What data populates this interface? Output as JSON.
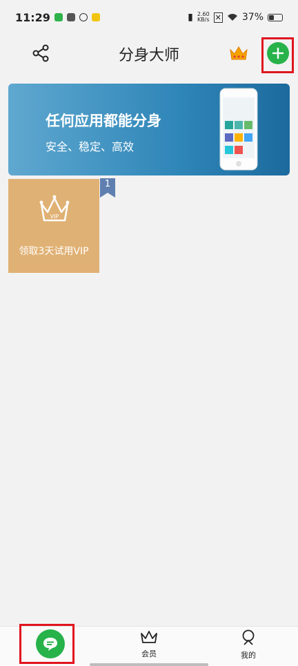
{
  "status_bar": {
    "time": "11:29",
    "speed_value": "2.60",
    "speed_unit": "KB/s",
    "battery": "37%"
  },
  "header": {
    "title": "分身大师",
    "icons": {
      "share": "share-icon",
      "crown": "crown-icon",
      "add": "plus-icon"
    }
  },
  "banner": {
    "title": "任何应用都能分身",
    "subtitle": "安全、稳定、高效"
  },
  "apps": [
    {
      "label": "领取3天试用VIP",
      "icon_text": "VIP",
      "badge": "1"
    }
  ],
  "bottom_nav": [
    {
      "id": "home",
      "label": "",
      "icon": "chat-bubble-icon"
    },
    {
      "id": "vip",
      "label": "会员",
      "icon": "crown-outline-icon"
    },
    {
      "id": "me",
      "label": "我的",
      "icon": "person-icon"
    }
  ],
  "colors": {
    "accent_green": "#27b24a",
    "highlight_red": "#e0141e",
    "vip_card": "#e0b174",
    "badge": "#5f7fb0"
  }
}
